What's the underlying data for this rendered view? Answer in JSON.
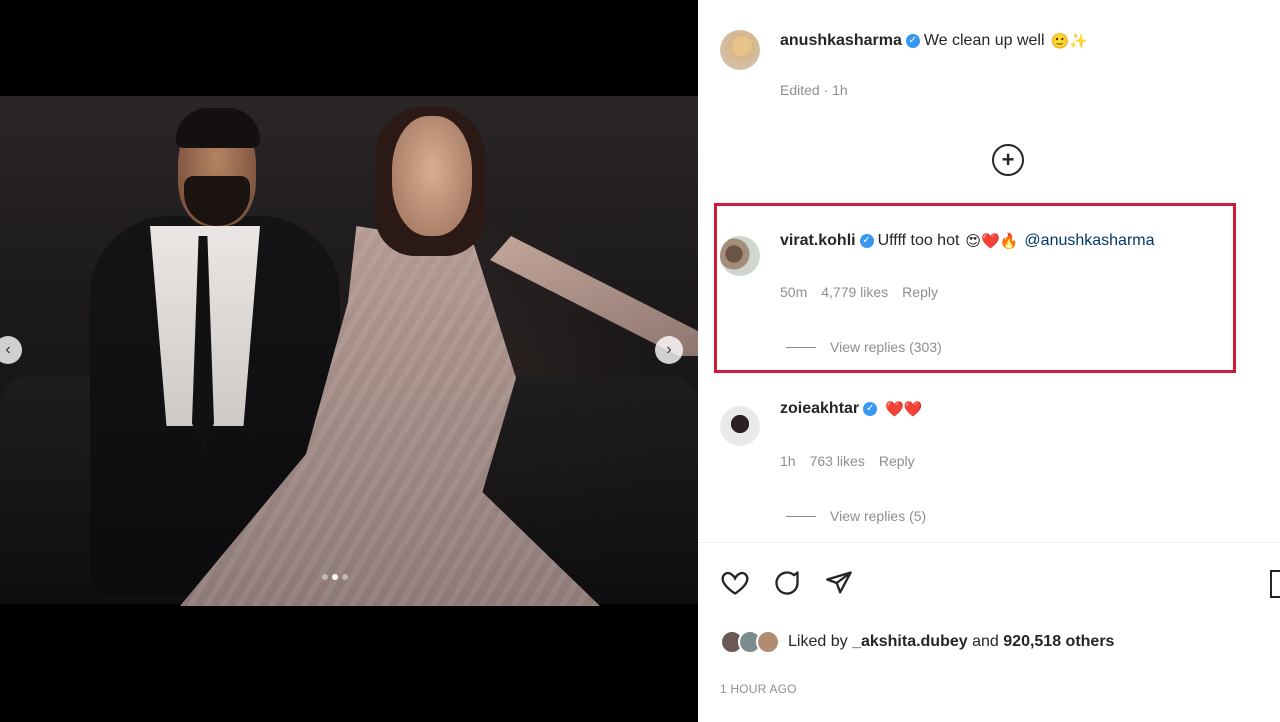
{
  "media": {
    "prev_icon": "‹",
    "next_icon": "›",
    "carousel_dots": 3,
    "active_dot": 2
  },
  "caption": {
    "username": "anushkasharma",
    "text": "We clean up well",
    "emoji": "🙂✨",
    "meta": "Edited · 1h"
  },
  "load_more_icon": "+",
  "comments": [
    {
      "username": "virat.kohli",
      "text": "Uffff too hot",
      "emoji": "😍❤️🔥",
      "mention": "@anushkasharma",
      "time": "50m",
      "likes": "4,779 likes",
      "reply": "Reply",
      "view_replies": "View replies (303)"
    },
    {
      "username": "zoieakhtar",
      "text": "",
      "emoji": "❤️❤️",
      "time": "1h",
      "likes": "763 likes",
      "reply": "Reply",
      "view_replies": "View replies (5)"
    }
  ],
  "likes": {
    "prefix": "Liked by",
    "user": "_akshita.dubey",
    "middle": "and",
    "others": "920,518 others"
  },
  "timestamp": "1 HOUR AGO",
  "colors": {
    "highlight_border": "#d11a3a",
    "verified": "#3897f0",
    "mention": "#00376b"
  }
}
